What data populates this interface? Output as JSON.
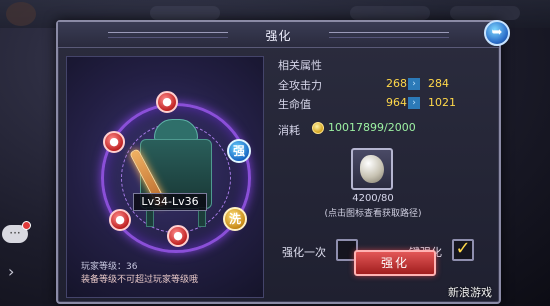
{
  "modal": {
    "title": "强化",
    "close_icon": "close-icon"
  },
  "item": {
    "level_range": "Lv34-Lv36",
    "player_level": "玩家等级：36",
    "equip_note": "装备等级不可超过玩家等级哦"
  },
  "attributes": {
    "section_title": "相关属性",
    "rows": [
      {
        "name": "全攻击力",
        "old": "268",
        "new": "284"
      },
      {
        "name": "生命值",
        "old": "964",
        "new": "1021"
      }
    ]
  },
  "cost": {
    "label": "消耗",
    "value": "10017899/2000"
  },
  "material": {
    "count": "4200/80",
    "hint": "(点击图标查看获取路径)"
  },
  "options": {
    "once_label": "强化一次",
    "once_checked": false,
    "one_key_label": "一键强化",
    "one_key_checked": true
  },
  "buttons": {
    "enhance": "强化"
  },
  "side": {
    "rune_marks": [
      "强",
      "洗"
    ],
    "lock_mark": "🔒"
  },
  "watermark": "新浪游戏",
  "colors": {
    "value_gold": "#ffd84a",
    "cost_green": "#9cf0a2",
    "button_red": "#c83030"
  }
}
